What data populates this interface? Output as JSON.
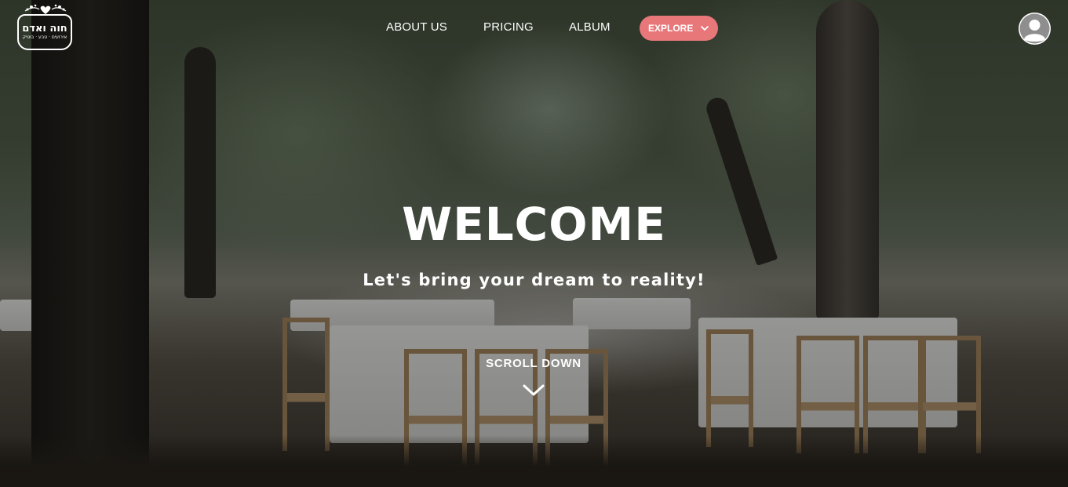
{
  "logo": {
    "title": "חוה ואדם",
    "subtitle": "אירועים · טבע · בוטיק",
    "icon": "floral-heart-icon"
  },
  "nav": {
    "links": [
      {
        "label": "ABOUT US"
      },
      {
        "label": "PRICING"
      },
      {
        "label": "ALBUM"
      }
    ],
    "explore": {
      "label": "EXPLORE",
      "icon": "chevron-down-icon"
    }
  },
  "user": {
    "icon": "user-avatar-icon"
  },
  "hero": {
    "title": "WELCOME",
    "tagline": "Let's bring your dream to reality!",
    "scroll_label": "SCROLL DOWN",
    "scroll_icon": "chevron-down-icon"
  },
  "colors": {
    "accent": "#e8777a",
    "text": "#ffffff"
  }
}
